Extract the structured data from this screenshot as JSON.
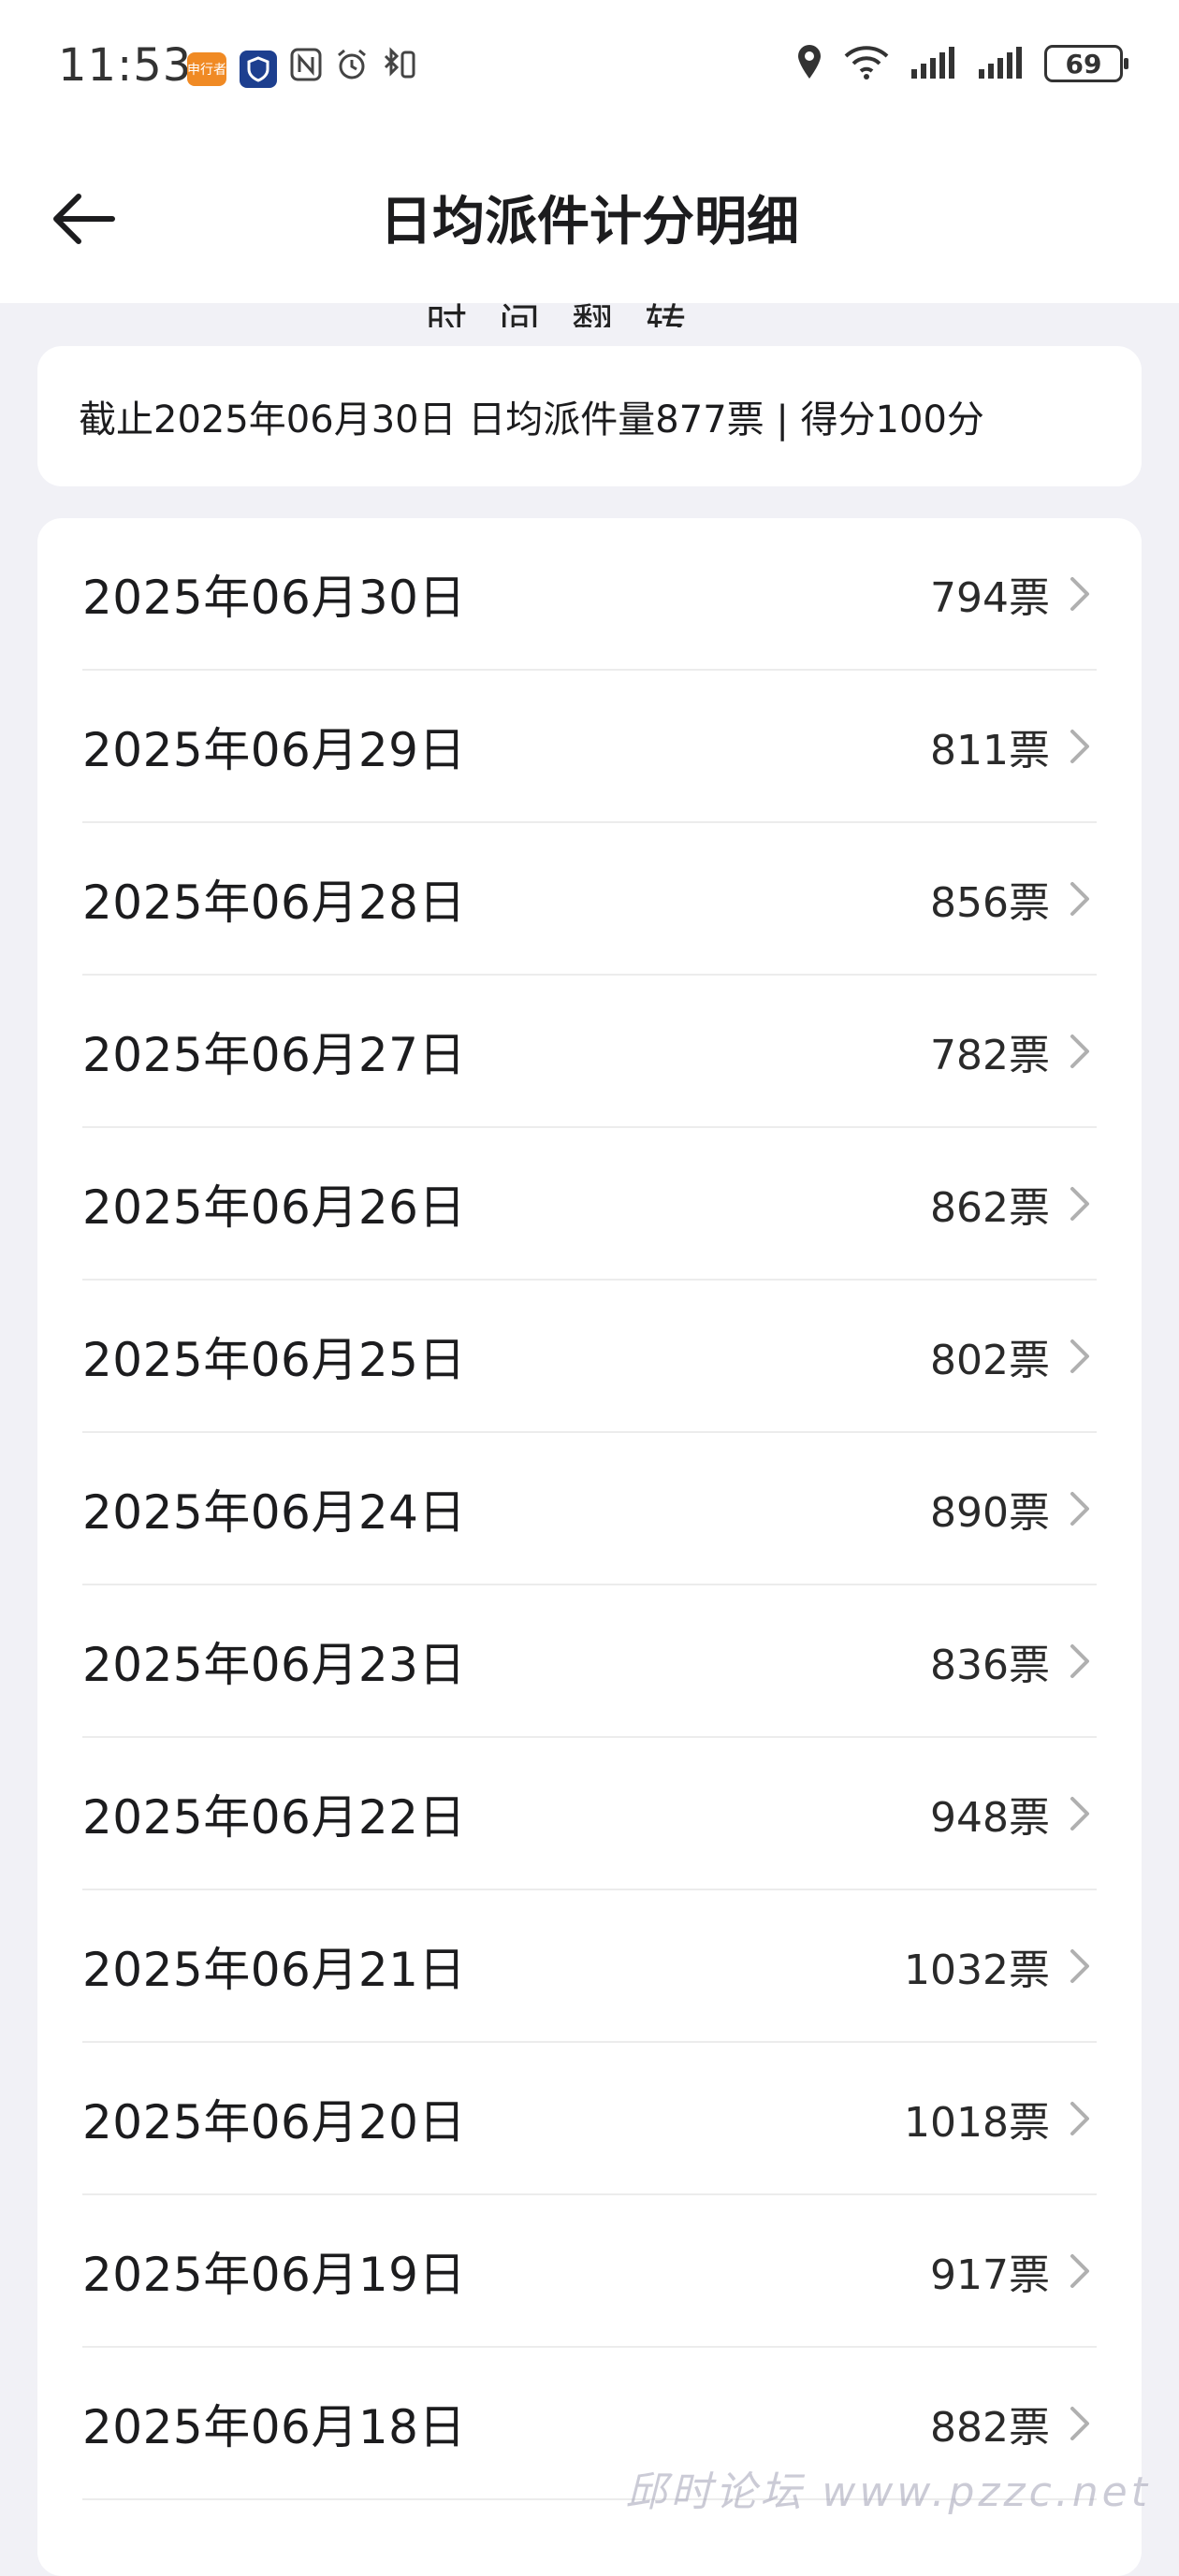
{
  "status_bar": {
    "time": "11:53",
    "app_badge": "申行者",
    "battery": "69",
    "icons": [
      "app-badge-icon",
      "shield-icon",
      "nfc-icon",
      "alarm-icon",
      "bluetooth-icon",
      "location-icon",
      "wifi-icon",
      "signal-icon",
      "signal-icon-2",
      "battery-icon"
    ]
  },
  "header": {
    "title": "日均派件计分明细",
    "back_icon": "arrow-left-icon"
  },
  "peek": {
    "text": "时间翻转"
  },
  "summary": {
    "text": "截止2025年06月30日 日均派件量877票 | 得分100分"
  },
  "rows": [
    {
      "date": "2025年06月30日",
      "count": "794票"
    },
    {
      "date": "2025年06月29日",
      "count": "811票"
    },
    {
      "date": "2025年06月28日",
      "count": "856票"
    },
    {
      "date": "2025年06月27日",
      "count": "782票"
    },
    {
      "date": "2025年06月26日",
      "count": "862票"
    },
    {
      "date": "2025年06月25日",
      "count": "802票"
    },
    {
      "date": "2025年06月24日",
      "count": "890票"
    },
    {
      "date": "2025年06月23日",
      "count": "836票"
    },
    {
      "date": "2025年06月22日",
      "count": "948票"
    },
    {
      "date": "2025年06月21日",
      "count": "1032票"
    },
    {
      "date": "2025年06月20日",
      "count": "1018票"
    },
    {
      "date": "2025年06月19日",
      "count": "917票"
    },
    {
      "date": "2025年06月18日",
      "count": "882票"
    }
  ],
  "watermark": "邱时论坛 www.pzzc.net"
}
